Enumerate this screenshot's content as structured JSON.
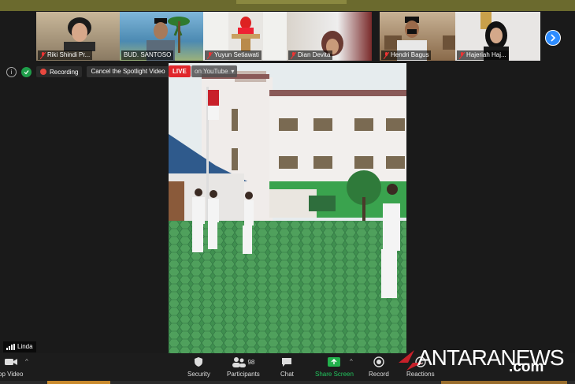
{
  "participants": [
    {
      "name": "Riki Shindi Pr..."
    },
    {
      "name": "BUD. SANTOSO"
    },
    {
      "name": "Yuyun Setiawati"
    },
    {
      "name": "Dian Devita"
    },
    {
      "name": "Hendri Bagus"
    },
    {
      "name": "Hajeriah Haj..."
    }
  ],
  "status": {
    "recording_label": "Recording",
    "spotlight_button": "Cancel the Spotlight Video",
    "live_badge": "LIVE",
    "stream_target": "on YouTube"
  },
  "active_speaker": "Linda",
  "toolbar": {
    "video_label": "op Video",
    "security_label": "Security",
    "participants_label": "Participants",
    "participants_count": "98",
    "chat_label": "Chat",
    "share_label": "Share Screen",
    "record_label": "Record",
    "reactions_label": "Reactions"
  },
  "watermark": {
    "main": "ANTARANEWS",
    "suffix": ".com"
  },
  "colors": {
    "live": "#e0262b",
    "share": "#22b14c",
    "accent": "#2d8cff",
    "recording": "#e8483f"
  }
}
